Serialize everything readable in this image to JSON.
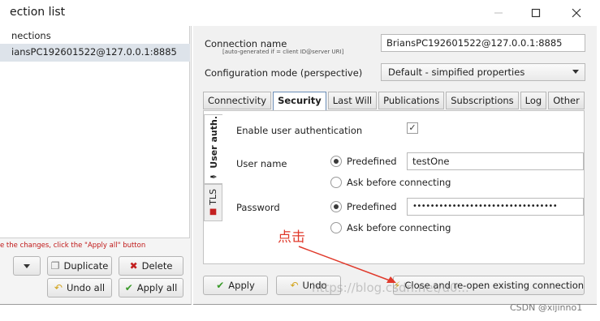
{
  "window": {
    "title": "ection list"
  },
  "left": {
    "list_header": "nections",
    "selected_connection": "iansPC192601522@127.0.0.1:8885",
    "hint": "e the changes, click the \"Apply all\" button",
    "buttons": {
      "duplicate": "Duplicate",
      "delete": "Delete",
      "undo_all": "Undo all",
      "apply_all": "Apply all"
    }
  },
  "right": {
    "connection_name_label": "Connection name",
    "connection_name_sub": "[auto-generated if = client ID@server URI]",
    "connection_name_value": "BriansPC192601522@127.0.0.1:8885",
    "config_mode_label": "Configuration mode (perspective)",
    "config_mode_value": "Default - simpified properties",
    "tabs": [
      "Connectivity",
      "Security",
      "Last Will",
      "Publications",
      "Subscriptions",
      "Log",
      "Other"
    ],
    "active_tab": "Security",
    "vertical_tabs": [
      "User auth.",
      "TLS"
    ],
    "security": {
      "enable_auth_label": "Enable user authentication",
      "enable_auth_checked": true,
      "username_label": "User name",
      "predefined_label": "Predefined",
      "ask_label": "Ask before connecting",
      "username_value": "testOne",
      "password_label": "Password",
      "password_value": "•••••••••••••••••••••••••••••••••"
    },
    "buttons": {
      "apply": "Apply",
      "undo": "Undo",
      "close_reopen": "Close and re-open existing connection"
    }
  },
  "annotation": {
    "text": "点击"
  },
  "watermark": "https://blog.csdn.net/u0...",
  "credit": "CSDN @xijinno1",
  "colors": {
    "accent_red": "#e0392b",
    "selection": "#dde3ea",
    "active_tab_border": "#6d8fb8"
  }
}
